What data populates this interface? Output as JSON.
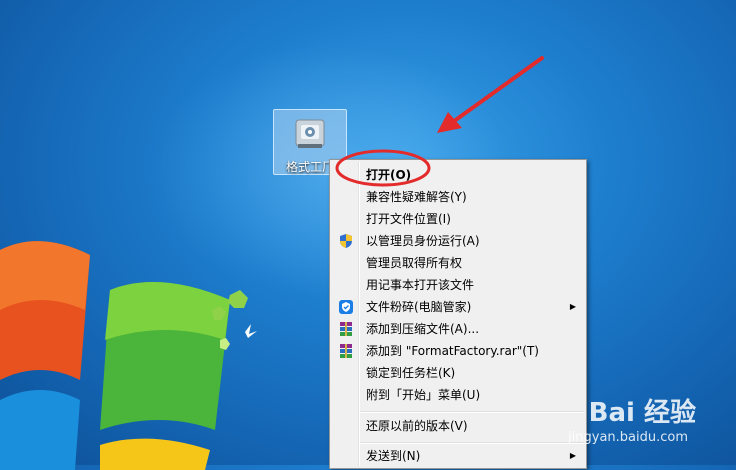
{
  "desktop": {
    "icon_label": "格式工厂",
    "watermark_brand": "Bai 经验",
    "watermark_url": "jingyan.baidu.com"
  },
  "context_menu": {
    "items": [
      {
        "label": "打开(O)",
        "bold": true,
        "icon": ""
      },
      {
        "label": "兼容性疑难解答(Y)",
        "icon": ""
      },
      {
        "label": "打开文件位置(I)",
        "icon": ""
      },
      {
        "label": "以管理员身份运行(A)",
        "icon": "uac-shield-icon"
      },
      {
        "label": "管理员取得所有权",
        "icon": ""
      },
      {
        "label": "用记事本打开该文件",
        "icon": ""
      },
      {
        "label": "文件粉碎(电脑管家)",
        "icon": "tencent-manager-icon",
        "submenu": true
      },
      {
        "label": "添加到压缩文件(A)...",
        "icon": "winrar-icon"
      },
      {
        "label": "添加到 \"FormatFactory.rar\"(T)",
        "icon": "winrar-icon"
      },
      {
        "label": "锁定到任务栏(K)",
        "icon": ""
      },
      {
        "label": "附到「开始」菜单(U)",
        "icon": ""
      },
      {
        "label": "还原以前的版本(V)",
        "icon": ""
      },
      {
        "label": "发送到(N)",
        "icon": "",
        "submenu": true
      }
    ]
  },
  "colors": {
    "annotation_red": "#e32b2b",
    "desktop_blue": "#1e7fcf"
  }
}
